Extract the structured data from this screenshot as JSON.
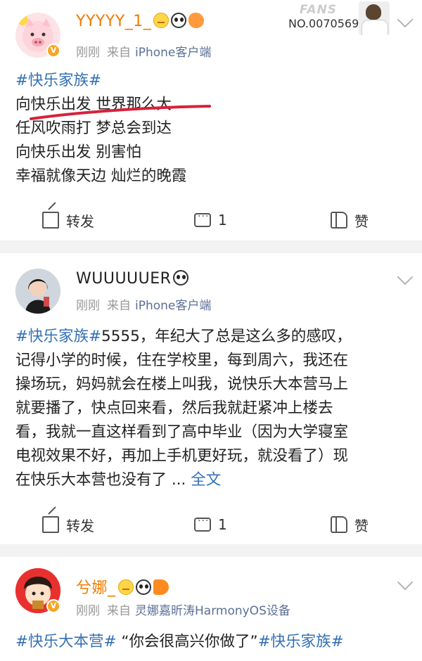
{
  "posts": [
    {
      "username": "YYYYY_1_",
      "username_color": "#f27b00",
      "emojis": [
        "crown-icon",
        "panda-icon",
        "fish-icon"
      ],
      "fans_badge": {
        "tag": "FANS",
        "number": "NO.0070569"
      },
      "time": "刚刚",
      "source_prefix": "来自",
      "source": "iPhone客户端",
      "lines": [
        "#快乐家族#",
        "向快乐出发 世界那么大",
        "任风吹雨打 梦总会到达",
        "向快乐出发 别害怕",
        "幸福就像天边 灿烂的晚霞"
      ],
      "repost_label": "转发",
      "comment_count": "1",
      "like_label": "赞"
    },
    {
      "username": "WUUUUUER",
      "username_color": "#222222",
      "emojis": [
        "panda-icon"
      ],
      "time": "刚刚",
      "source_prefix": "来自",
      "source": "iPhone客户端",
      "topic": "#快乐家族#",
      "lines": [
        "5555，年纪大了总是这么多的感叹，",
        "记得小学的时候，住在学校里，每到周六，我还在",
        "操场玩，妈妈就会在楼上叫我，说快乐大本营马上",
        "就要播了，快点回来看，然后我就赶紧冲上楼去",
        "看，我就一直这样看到了高中毕业（因为大学寝室",
        "电视效果不好，再加上手机更好玩，就没看了）现",
        "在快乐大本营也没有了 ..."
      ],
      "more_link": "全文",
      "repost_label": "转发",
      "comment_count": "1",
      "like_label": "赞"
    },
    {
      "username": "兮娜_",
      "username_color": "#f27b00",
      "emojis": [
        "crown-icon",
        "panda-icon",
        "horn-icon"
      ],
      "time": "刚刚",
      "source_prefix": "来自",
      "source": "灵娜嘉昕涛HarmonyOS设备",
      "topic1": "#快乐大本营#",
      "quote": " “你会很高兴你做了”",
      "topic2": "#快乐家族#"
    }
  ],
  "colors": {
    "topic": "#3470b4",
    "meta": "#999999",
    "source": "#5b6f96",
    "background": "#f2f2f2",
    "underline_mark": "#d9213a"
  }
}
